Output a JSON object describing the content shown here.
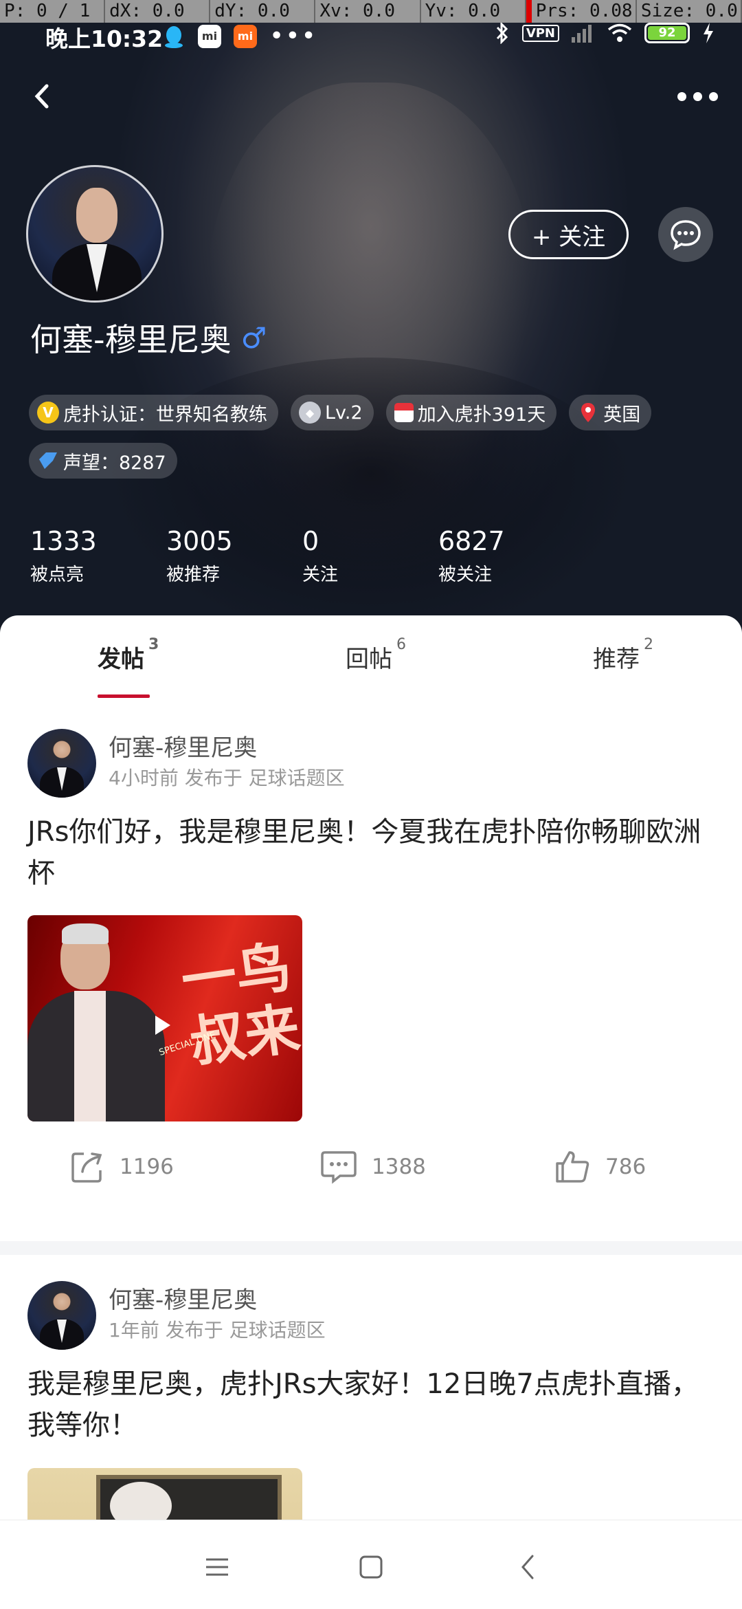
{
  "debug": {
    "p": "P: 0 / 1",
    "dx": "dX: 0.0",
    "dy": "dY: 0.0",
    "xv": "Xv: 0.0",
    "yv": "Yv: 0.0",
    "prs": "Prs: 0.08",
    "size": "Size: 0.0"
  },
  "status": {
    "time": "晚上10:32",
    "vpn": "VPN",
    "battery": "92",
    "app_icons": [
      "qq-icon",
      "mi-store-icon",
      "mi-icon"
    ],
    "mi_label": "mi",
    "mi2_label": "mi"
  },
  "profile": {
    "name": "何塞-穆里尼奥",
    "gender_symbol": "♂",
    "follow_label": "+ 关注",
    "badges": [
      {
        "icon": "verified-icon",
        "glyph": "V",
        "text": "虎扑认证：世界知名教练"
      },
      {
        "icon": "level-icon",
        "glyph": "◆",
        "text": "Lv.2"
      },
      {
        "icon": "calendar-icon",
        "glyph": "",
        "text": "加入虎扑391天"
      },
      {
        "icon": "location-pin-icon",
        "glyph": "📍",
        "text": "英国"
      },
      {
        "icon": "reputation-icon",
        "glyph": "◆",
        "text": "声望：8287"
      }
    ],
    "stats": [
      {
        "num": "1333",
        "label": "被点亮"
      },
      {
        "num": "3005",
        "label": "被推荐"
      },
      {
        "num": "0",
        "label": "关注"
      },
      {
        "num": "6827",
        "label": "被关注"
      }
    ]
  },
  "tabs": [
    {
      "label": "发帖",
      "count": "3",
      "active": true
    },
    {
      "label": "回帖",
      "count": "6",
      "active": false
    },
    {
      "label": "推荐",
      "count": "2",
      "active": false
    }
  ],
  "posts": [
    {
      "author": "何塞-穆里尼奥",
      "meta": "4小时前 发布于 足球话题区",
      "text": "JRs你们好，我是穆里尼奥！今夏我在虎扑陪你畅聊欧洲杯",
      "image_text": "一鸟叔来",
      "image_subtext": "SPECIAL ONE",
      "shares": "1196",
      "comments": "1388",
      "likes": "786"
    },
    {
      "author": "何塞-穆里尼奥",
      "meta": "1年前 发布于 足球话题区",
      "text": "我是穆里尼奥，虎扑JRs大家好！12日晚7点虎扑直播，我等你！"
    }
  ],
  "colors": {
    "accent": "#c8102e",
    "gender": "#4a8dff",
    "battery": "#7bd43c"
  }
}
